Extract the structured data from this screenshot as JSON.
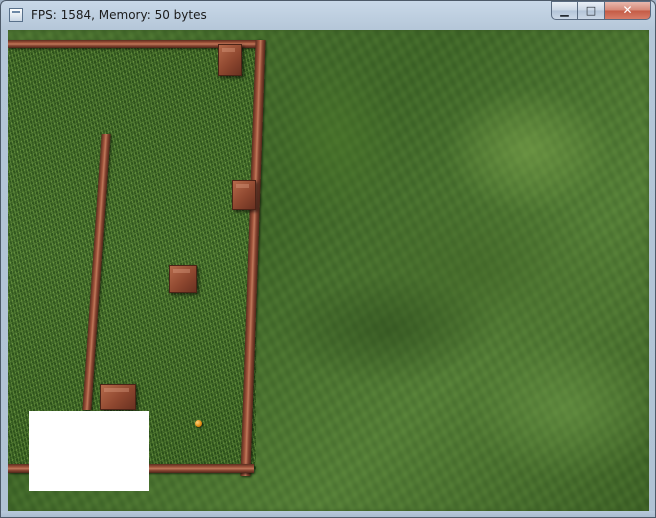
{
  "window": {
    "title": "FPS: 1584, Memory: 50 bytes",
    "buttons": {
      "minimize": "▁",
      "maximize": "□",
      "close": "✕"
    }
  },
  "scene": {
    "colors": {
      "grass": "#4b7d30",
      "wood": "#a2553c",
      "ball": "#e08a10",
      "minimap": "#ffffff"
    }
  }
}
